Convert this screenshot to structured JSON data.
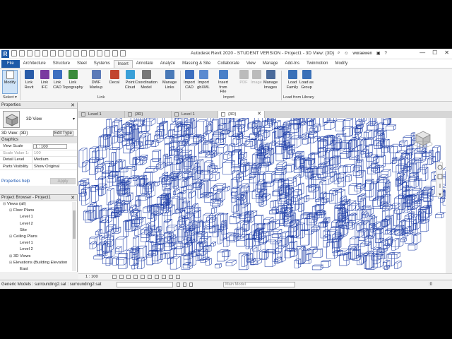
{
  "window": {
    "title": "Autodesk Revit 2020 - STUDENT VERSION - Project1 - 3D View: {3D}",
    "username": "woraewen",
    "min": "—",
    "max": "☐",
    "close": "✕"
  },
  "app_logo": "R",
  "ribbon_tabs": [
    "File",
    "Architecture",
    "Structure",
    "Steel",
    "Systems",
    "Insert",
    "Annotate",
    "Analyze",
    "Massing & Site",
    "Collaborate",
    "View",
    "Manage",
    "Add-Ins",
    "Twinmotion",
    "Modify"
  ],
  "active_tab": "Insert",
  "ribbon": {
    "modify": "Modify",
    "buttons": [
      {
        "l1": "Link",
        "l2": "Revit",
        "color": "#2a5ca8"
      },
      {
        "l1": "Link",
        "l2": "IFC",
        "color": "#7a3aa0"
      },
      {
        "l1": "Link",
        "l2": "CAD",
        "color": "#3d6fbf"
      },
      {
        "l1": "Link",
        "l2": "Topography",
        "color": "#3a8a3a"
      },
      {
        "l1": "DWF",
        "l2": "Markup",
        "color": "#5b7ab8"
      },
      {
        "l1": "Decal",
        "l2": "",
        "color": "#c2452f"
      },
      {
        "l1": "Point",
        "l2": "Cloud",
        "color": "#3aa0d8"
      },
      {
        "l1": "Coordination",
        "l2": "Model",
        "color": "#777777"
      },
      {
        "l1": "Manage",
        "l2": "Links",
        "color": "#4a7ab8"
      },
      {
        "l1": "Import",
        "l2": "CAD",
        "color": "#3d6fbf"
      },
      {
        "l1": "Import",
        "l2": "gbXML",
        "color": "#5a8ad0"
      },
      {
        "l1": "Insert",
        "l2": "from File",
        "color": "#4a80c8"
      },
      {
        "l1": "PDF",
        "l2": "",
        "color": "#bbbbbb",
        "disabled": true
      },
      {
        "l1": "Image",
        "l2": "",
        "color": "#bbbbbb",
        "disabled": true
      },
      {
        "l1": "Manage",
        "l2": "Images",
        "color": "#4a6a9a"
      },
      {
        "l1": "Load",
        "l2": "Family",
        "color": "#3a70b8"
      },
      {
        "l1": "Load as",
        "l2": "Group",
        "color": "#3a70b8"
      }
    ],
    "groups": {
      "select": "Select ▾",
      "link": "Link",
      "import": "Import",
      "load_library": "Load from Library"
    }
  },
  "properties": {
    "header": "Properties",
    "type_label": "3D View",
    "view_selector": "3D View: {3D}",
    "edit_type": "Edit Type",
    "section": "Graphics",
    "rows": [
      {
        "k": "View Scale",
        "v": "1 : 100",
        "boxed": true
      },
      {
        "k": "Scale Value 1:",
        "v": "100",
        "dim": true
      },
      {
        "k": "Detail Level",
        "v": "Medium"
      },
      {
        "k": "Parts Visibility",
        "v": "Show Original"
      }
    ],
    "help_link": "Properties help",
    "apply": "Apply"
  },
  "project_browser": {
    "header": "Project Browser - Project1",
    "items": [
      {
        "label": "Views (all)",
        "indent": 0,
        "toggle": "⊟"
      },
      {
        "label": "Floor Plans",
        "indent": 1,
        "toggle": "⊟"
      },
      {
        "label": "Level 1",
        "indent": 2,
        "toggle": ""
      },
      {
        "label": "Level 2",
        "indent": 2,
        "toggle": ""
      },
      {
        "label": "Site",
        "indent": 2,
        "toggle": ""
      },
      {
        "label": "Ceiling Plans",
        "indent": 1,
        "toggle": "⊟"
      },
      {
        "label": "Level 1",
        "indent": 2,
        "toggle": ""
      },
      {
        "label": "Level 2",
        "indent": 2,
        "toggle": ""
      },
      {
        "label": "3D Views",
        "indent": 1,
        "toggle": "⊞"
      },
      {
        "label": "Elevations (Building Elevation",
        "indent": 1,
        "toggle": "⊟"
      },
      {
        "label": "East",
        "indent": 2,
        "toggle": ""
      }
    ]
  },
  "view_tabs": [
    {
      "label": "Level 1",
      "active": false
    },
    {
      "label": "{3D}",
      "active": false
    },
    {
      "label": "Level 1",
      "active": false
    },
    {
      "label": "{3D}",
      "active": true
    }
  ],
  "view_control": {
    "scale": "1 : 100"
  },
  "status": {
    "message": "Generic Models : surrounding2.sat : surrounding2.sat",
    "model": "Main Model",
    "count": ":0"
  },
  "colors": {
    "file_tab": "#1e5aa8",
    "building_lines": "#1f3fa8",
    "selection": "#cfe3f7"
  }
}
